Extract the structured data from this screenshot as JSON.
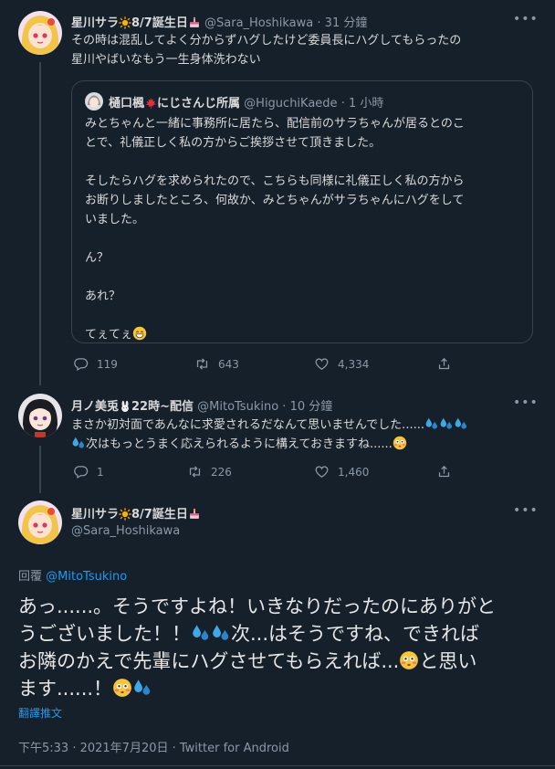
{
  "tweet1": {
    "display_name": "星川サラ",
    "name_suffix": "8/7誕生日",
    "handle": "@Sara_Hoshikawa",
    "time": "31 分鐘",
    "text_line1": "その時は混乱してよく分からずハグしたけど委員長にハグしてもらったの",
    "text_line2": "星川やばいなもう一生身体洗わない",
    "quote": {
      "display_name": "樋口楓",
      "name_suffix": "にじさんじ所属",
      "handle": "@HiguchiKaede",
      "time": "1 小時",
      "p1_line1": "みとちゃんと一緒に事務所に居たら、配信前のサラちゃんが居るとのこ",
      "p1_line2": "とで、礼儀正しく私の方からご挨拶させて頂きました。",
      "p2_line1": "そしたらハグを求められたので、こちらも同様に礼儀正しく私の方から",
      "p2_line2": "お断りしましたところ、何故か、みとちゃんがサラちゃんにハグをして",
      "p2_line3": "いました。",
      "p3": "ん？",
      "p4": "あれ？",
      "p5": "てぇてぇ"
    },
    "replies": "119",
    "retweets": "643",
    "likes": "4,334"
  },
  "tweet2": {
    "display_name": "月ノ美兎",
    "name_suffix": "22時~配信",
    "handle": "@MitoTsukino",
    "time": "10 分鐘",
    "text_line1": "まさか初対面であんなに求愛されるだなんて思いませんでした......",
    "text_line2": "次はもっとうまく応えられるように構えておきますね......",
    "replies": "1",
    "retweets": "226",
    "likes": "1,460"
  },
  "tweet3": {
    "display_name": "星川サラ",
    "name_suffix": "8/7誕生日",
    "handle": "@Sara_Hoshikawa",
    "reply_prefix": "回覆",
    "reply_to": "@MitoTsukino",
    "line1": "あっ......。そうですよね！いきなりだったのにありがと",
    "line2a": "うございました！！",
    "line2b": "次...はそうですね、できれば",
    "line3a": "お隣のかえで先輩にハグさせてもらえれば...",
    "line3b": "と思い",
    "line4": "ます......！",
    "translate": "翻譯推文",
    "meta": "下午5:33 · 2021年7月20日 · Twitter for Android"
  },
  "icons": {
    "reply": "reply-icon",
    "retweet": "retweet-icon",
    "like": "heart-icon",
    "share": "share-icon",
    "more": "more-icon",
    "sun": "sun-emoji",
    "cake": "cake-emoji",
    "maple": "maple-leaf-emoji",
    "rabbit": "rabbit-emoji",
    "sweat": "sweat-droplets-emoji",
    "flushed": "flushed-face-emoji",
    "grin": "grinning-face-emoji"
  },
  "colors": {
    "background": "#15202b",
    "text": "#d9d9d9",
    "muted": "#8b98a5",
    "link": "#1d9bf0",
    "border": "#38444d"
  }
}
